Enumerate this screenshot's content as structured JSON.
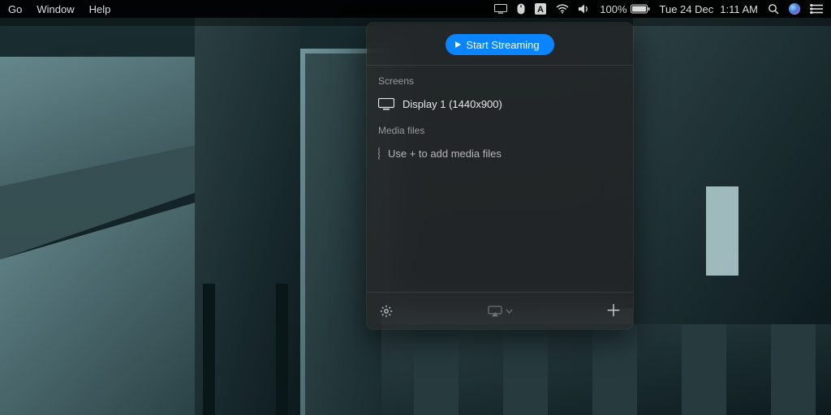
{
  "menubar": {
    "left": [
      "Go",
      "Window",
      "Help"
    ],
    "battery_percent": "100%",
    "date": "Tue 24 Dec",
    "time": "1:11 AM"
  },
  "panel": {
    "start_label": "Start Streaming",
    "sections": {
      "screens": {
        "label": "Screens",
        "display_name": "Display 1 (1440x900)"
      },
      "media": {
        "label": "Media files",
        "empty_text": "Use + to add media files"
      }
    }
  },
  "icons": {
    "display": "display-icon",
    "mouse": "mouse-icon",
    "text_input": "text-input-icon",
    "wifi": "wifi-icon",
    "volume": "volume-icon",
    "battery": "battery-icon",
    "spotlight": "spotlight-icon",
    "siri": "siri-icon",
    "notifications": "notification-center-icon",
    "gear": "gear-icon",
    "airplay": "airplay-icon",
    "add": "add-icon",
    "monitor": "monitor-icon",
    "dotted_circle": "dotted-circle-icon",
    "play": "play-icon",
    "chevron_down": "chevron-down-icon"
  }
}
